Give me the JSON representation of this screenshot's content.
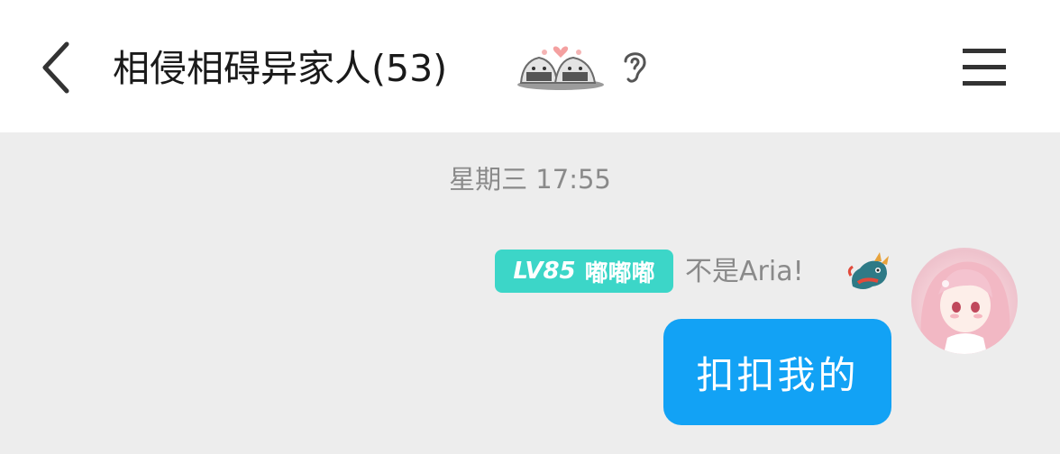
{
  "header": {
    "title": "相侵相碍异家人(53)",
    "back_icon": "chevron-left-icon",
    "sticker_icon": "rice-ball-couple-sticker",
    "ear_icon": "ear-icon",
    "menu_icon": "hamburger-menu-icon"
  },
  "chat": {
    "timestamp": "星期三 17:55",
    "messages": [
      {
        "level": "LV85",
        "title_badge": "嘟嘟嘟",
        "sender": "不是Aria!",
        "text": "扣扣我的",
        "bubble_color": "#12a2f5",
        "badge_color": "#3cd6c8"
      }
    ]
  }
}
